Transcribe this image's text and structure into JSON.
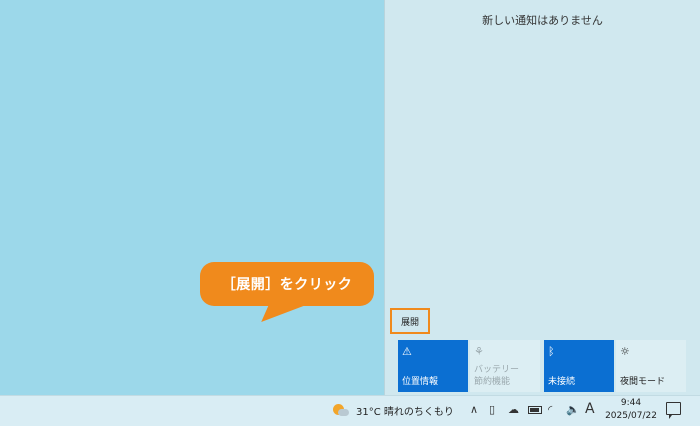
{
  "action_center": {
    "title": "新しい通知はありません",
    "expand_label": "展開",
    "tiles": [
      {
        "label": "位置情報",
        "icon": "location-icon",
        "glyph": "⚠",
        "state": "on"
      },
      {
        "label": "バッテリー\n節約機能",
        "icon": "battery-saver-icon",
        "glyph": "⚘",
        "state": "off"
      },
      {
        "label": "未接続",
        "icon": "bluetooth-icon",
        "glyph": "ᛒ",
        "state": "on"
      },
      {
        "label": "夜間モード",
        "icon": "night-light-icon",
        "glyph": "☼",
        "state": "neutral"
      }
    ]
  },
  "callout": {
    "text": "［展開］をクリック"
  },
  "taskbar": {
    "weather": "31°C  晴れのちくもり",
    "ime": "A",
    "time": "9:44",
    "date": "2025/07/22",
    "glyphs": {
      "chevron": "∧",
      "meet": "▯",
      "onedrive": "☁",
      "wifi": "◜",
      "volume": "🔈"
    }
  },
  "colors": {
    "accent": "#f08a1c",
    "tile_on": "#0b6fd2",
    "desktop": "#9cd8ea",
    "panel": "#d0e8ef"
  }
}
